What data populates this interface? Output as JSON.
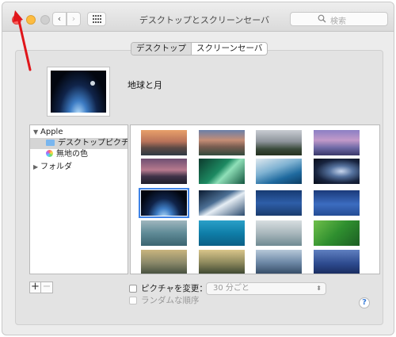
{
  "window": {
    "title": "デスクトップとスクリーンセーバ",
    "search_placeholder": "検索",
    "back_glyph": "‹",
    "forward_glyph": "›"
  },
  "tabs": [
    {
      "label": "デスクトップ",
      "selected": true
    },
    {
      "label": "スクリーンセーバ",
      "selected": false
    }
  ],
  "current_picture": {
    "name": "地球と月"
  },
  "sidebar": {
    "apple_group": "Apple",
    "desktop_pictures": "デスクトップピクチャ",
    "solid_colors": "無地の色",
    "folders_group": "フォルダ"
  },
  "controls": {
    "add": "+",
    "remove": "−",
    "change_picture_label": "ピクチャを変更：",
    "change_picture_checked": false,
    "interval": "30 分ごと",
    "random_order_label": "ランダムな順序",
    "random_order_checked": false,
    "help": "?"
  },
  "colors": {
    "accent": "#3f83e6",
    "close": "#fc605c",
    "minimize": "#fdbc40",
    "annotation_arrow": "#e0161b"
  },
  "gallery": [
    {
      "name": "yosemite-sunset",
      "selected": false
    },
    {
      "name": "half-dome-dusk",
      "selected": false
    },
    {
      "name": "yosemite-valley",
      "selected": false
    },
    {
      "name": "half-dome-purple",
      "selected": false
    },
    {
      "name": "lake-rocks-dusk",
      "selected": false
    },
    {
      "name": "green-wave",
      "selected": false
    },
    {
      "name": "blue-wave",
      "selected": false
    },
    {
      "name": "galaxy",
      "selected": false
    },
    {
      "name": "earth-and-moon",
      "selected": true
    },
    {
      "name": "earth-horizon",
      "selected": false
    },
    {
      "name": "milky-way-blue",
      "selected": false
    },
    {
      "name": "crescent-moon",
      "selected": false
    },
    {
      "name": "clouds",
      "selected": false
    },
    {
      "name": "blue-water",
      "selected": false
    },
    {
      "name": "foggy-coast",
      "selected": false
    },
    {
      "name": "green-fields",
      "selected": false
    },
    {
      "name": "foggy-valley",
      "selected": false
    },
    {
      "name": "sunbeams-forest",
      "selected": false
    },
    {
      "name": "mountain-haze",
      "selected": false
    },
    {
      "name": "blue-dusk",
      "selected": false
    }
  ]
}
